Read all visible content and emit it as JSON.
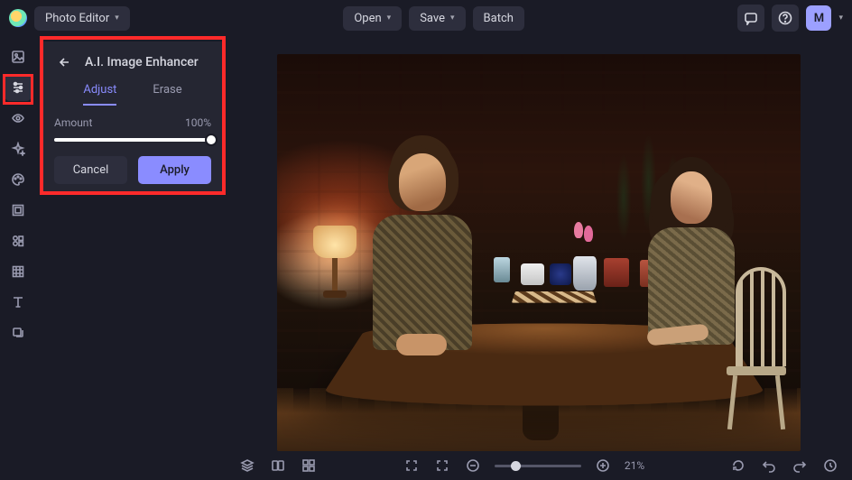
{
  "header": {
    "app_mode": "Photo Editor",
    "open": "Open",
    "save": "Save",
    "batch": "Batch",
    "avatar_initial": "M"
  },
  "sidebar": {
    "items": [
      {
        "name": "image-tool"
      },
      {
        "name": "adjust-tool",
        "active": true
      },
      {
        "name": "eye-tool"
      },
      {
        "name": "sparkle-tool"
      },
      {
        "name": "palette-tool"
      },
      {
        "name": "frame-tool"
      },
      {
        "name": "elements-tool"
      },
      {
        "name": "texture-tool"
      },
      {
        "name": "text-tool"
      },
      {
        "name": "layers-tool"
      }
    ]
  },
  "panel": {
    "title": "A.I. Image Enhancer",
    "tabs": {
      "adjust": "Adjust",
      "erase": "Erase",
      "active": "adjust"
    },
    "slider": {
      "label": "Amount",
      "value_text": "100%",
      "value": 100
    },
    "cancel": "Cancel",
    "apply": "Apply"
  },
  "bottombar": {
    "zoom_text": "21%",
    "zoom_value": 21
  }
}
